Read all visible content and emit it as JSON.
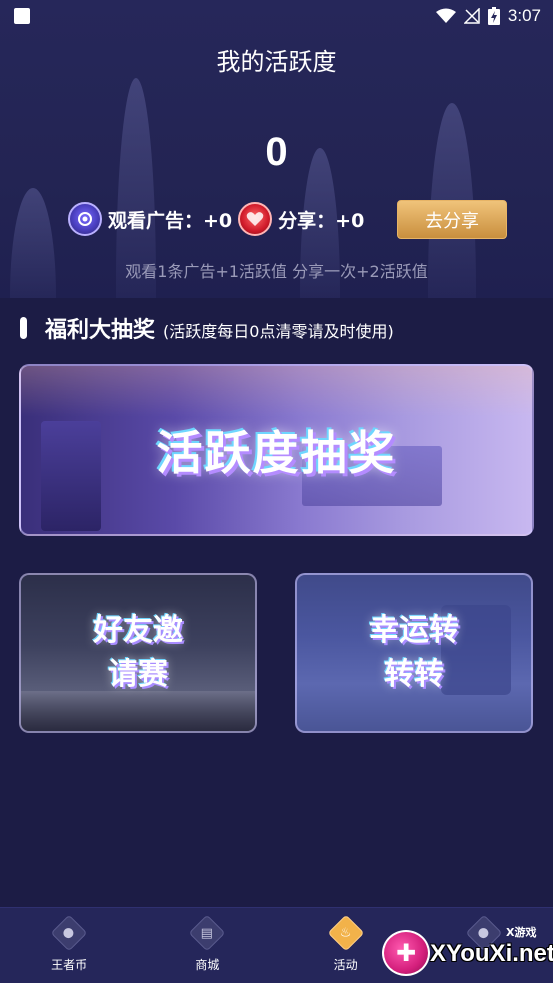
{
  "status_bar": {
    "time": "3:07",
    "icons": [
      "app-notification-icon",
      "wifi-icon",
      "no-signal-icon",
      "battery-charging-icon"
    ]
  },
  "header": {
    "title": "我的活跃度",
    "activity_value": "0",
    "ad_reward": {
      "label": "观看广告：",
      "value": "+0",
      "icon": "ad-medal-icon"
    },
    "share_reward": {
      "label": "分享：",
      "value": "+0",
      "icon": "heart-medal-icon"
    },
    "share_button": "去分享",
    "hint": "观看1条广告+1活跃值 分享一次+2活跃值"
  },
  "lottery_section": {
    "title": "福利大抽奖",
    "note": "(活跃度每日0点清零请及时使用)",
    "cards": {
      "main": {
        "label": "活跃度抽奖"
      },
      "invite": {
        "line1": "好友邀",
        "line2": "请赛"
      },
      "spin": {
        "line1": "幸运转",
        "line2": "转转"
      }
    }
  },
  "bottom_nav": {
    "items": [
      {
        "label": "王者币",
        "icon": "coin-icon",
        "glyph": "●"
      },
      {
        "label": "商城",
        "icon": "store-icon",
        "glyph": "▤"
      },
      {
        "label": "活动",
        "icon": "flame-icon",
        "glyph": "♨"
      },
      {
        "label": "",
        "icon": "profile-icon",
        "glyph": "●"
      }
    ],
    "active_index": 2
  },
  "watermark": {
    "brand": "XYouXi.net",
    "small": "X游戏"
  },
  "colors": {
    "background": "#1c1c45",
    "button_gold": "#d9a556",
    "nav_active": "#f2b24a"
  }
}
